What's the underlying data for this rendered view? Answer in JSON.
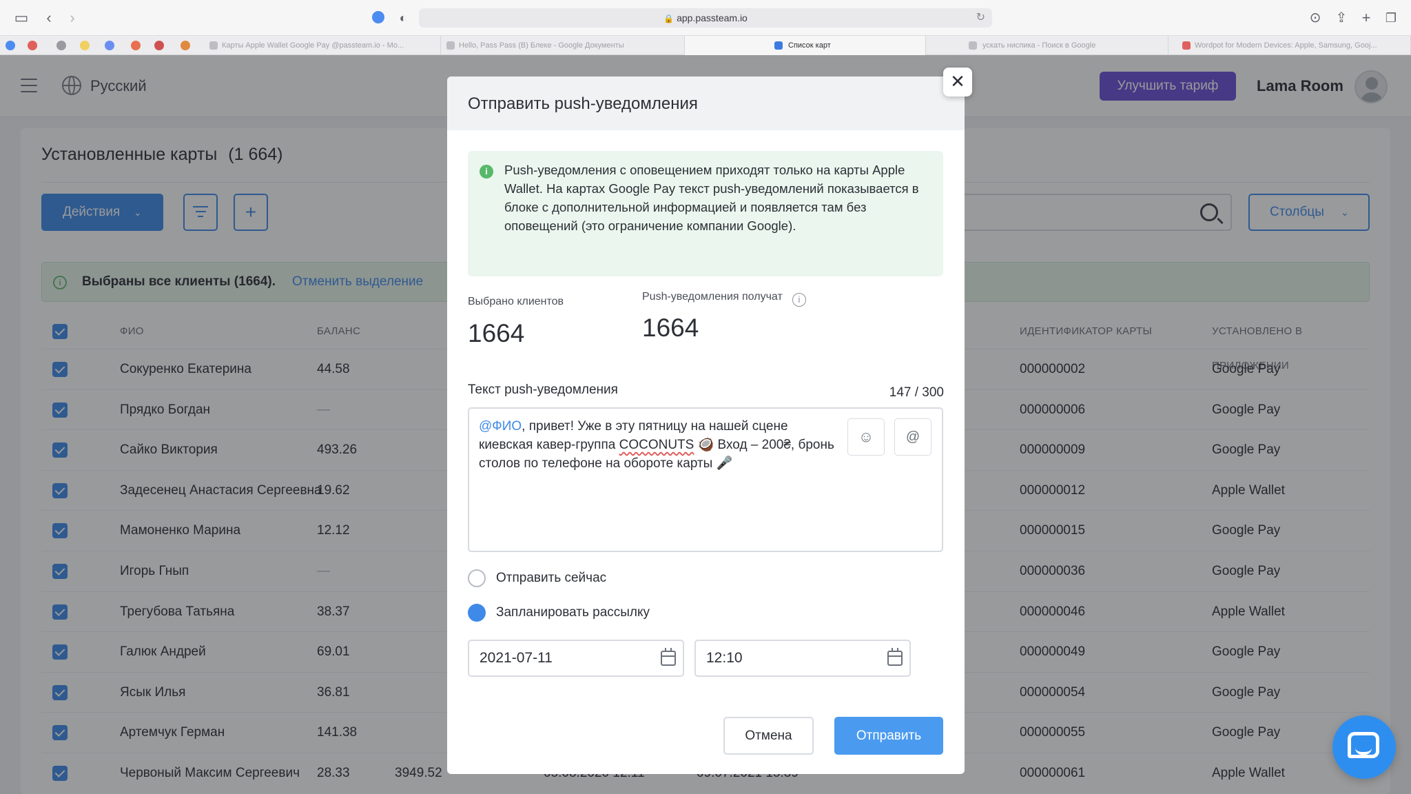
{
  "browser": {
    "url": "app.passteam.io",
    "tabs": [
      {
        "label": "Карты Apple Wallet Google Pay @passteam.io - Мо..."
      },
      {
        "label": "Hello, Pass Pass (В) Блеке - Google Документы"
      },
      {
        "label": "Список карт"
      },
      {
        "label": "ускать ниспика - Поиск в Google"
      },
      {
        "label": "Wordpot for Modern Devices: Apple, Samsung, Gooj..."
      }
    ]
  },
  "header": {
    "language": "Русский",
    "upgrade_label": "Улучшить тариф",
    "account_name": "Lama Room"
  },
  "page": {
    "title": "Установленные карты",
    "count": "(1 664)",
    "actions_label": "Действия",
    "columns_label": "Столбцы",
    "banner_text": "Выбраны все клиенты (1664).",
    "banner_link": "Отменить выделение"
  },
  "table": {
    "columns": [
      "ФИО",
      "БАЛАНС",
      "ИДЕНТИФИКАТОР КАРТЫ",
      "УСТАНОВЛЕНО В ПРИЛОЖЕНИИ"
    ],
    "rows": [
      {
        "name": "Сокуренко Екатерина",
        "balance": "44.58",
        "c3": "",
        "c4": "",
        "c5": "",
        "card_id": "000000002",
        "app": "Google Pay"
      },
      {
        "name": "Прядко Богдан",
        "balance": "—",
        "c3": "",
        "c4": "",
        "c5": "",
        "card_id": "000000006",
        "app": "Google Pay"
      },
      {
        "name": "Сайко Виктория",
        "balance": "493.26",
        "c3": "",
        "c4": "",
        "c5": "",
        "card_id": "000000009",
        "app": "Google Pay"
      },
      {
        "name": "Задесенец Анастасия Сергеевна",
        "balance": "19.62",
        "c3": "",
        "c4": "",
        "c5": "",
        "card_id": "000000012",
        "app": "Apple Wallet"
      },
      {
        "name": "Мамоненко Марина",
        "balance": "12.12",
        "c3": "",
        "c4": "",
        "c5": "",
        "card_id": "000000015",
        "app": "Google Pay"
      },
      {
        "name": "Игорь Гнып",
        "balance": "—",
        "c3": "",
        "c4": "",
        "c5": "",
        "card_id": "000000036",
        "app": "Google Pay"
      },
      {
        "name": "Трегубова Татьяна",
        "balance": "38.37",
        "c3": "",
        "c4": "",
        "c5": "",
        "card_id": "000000046",
        "app": "Apple Wallet"
      },
      {
        "name": "Галюк Андрей",
        "balance": "69.01",
        "c3": "",
        "c4": "",
        "c5": "",
        "card_id": "000000049",
        "app": "Google Pay"
      },
      {
        "name": "Ясык Илья",
        "balance": "36.81",
        "c3": "",
        "c4": "",
        "c5": "",
        "card_id": "000000054",
        "app": "Google Pay"
      },
      {
        "name": "Артемчук Герман",
        "balance": "141.38",
        "c3": "",
        "c4": "",
        "c5": "",
        "card_id": "000000055",
        "app": "Google Pay"
      },
      {
        "name": "Червоный Максим Сергеевич",
        "balance": "28.33",
        "c3": "3949.52",
        "c4": "05.08.2020 12:11",
        "c5": "09.07.2021 15:39",
        "card_id": "000000061",
        "app": "Apple Wallet"
      }
    ]
  },
  "modal": {
    "title": "Отправить push-уведомления",
    "close_symbol": "✕",
    "info": "Push-уведомления с оповещением приходят только на карты Apple Wallet. На картах Google Pay текст push-уведомлений показывается в блоке с дополнительной информацией и появляется там без оповещений (это ограничение компании Google).",
    "selected_label": "Выбрано клиентов",
    "selected_value": "1664",
    "recipients_label": "Push-уведомления получат",
    "recipients_value": "1664",
    "text_label": "Текст push-уведомления",
    "counter": "147 / 300",
    "message": {
      "mention": "@ФИО",
      "part1": ", привет! Уже в эту пятницу на нашей сцене киевская кавер-группа ",
      "brand": "COCONUTS",
      "part2": " 🥥 Вход – 200₴, бронь столов по телефоне на обороте карты 🎤"
    },
    "emoji_symbol": "☺",
    "mention_symbol": "@",
    "send_now_label": "Отправить сейчас",
    "schedule_label": "Запланировать рассылку",
    "date_value": "2021-07-11",
    "time_value": "12:10",
    "cancel_label": "Отмена",
    "send_label": "Отправить"
  },
  "colors": {
    "accent": "#3f8ae8",
    "upgrade": "#6a4fd8",
    "info_bg": "#ebf6ee",
    "success": "#58b86a"
  }
}
